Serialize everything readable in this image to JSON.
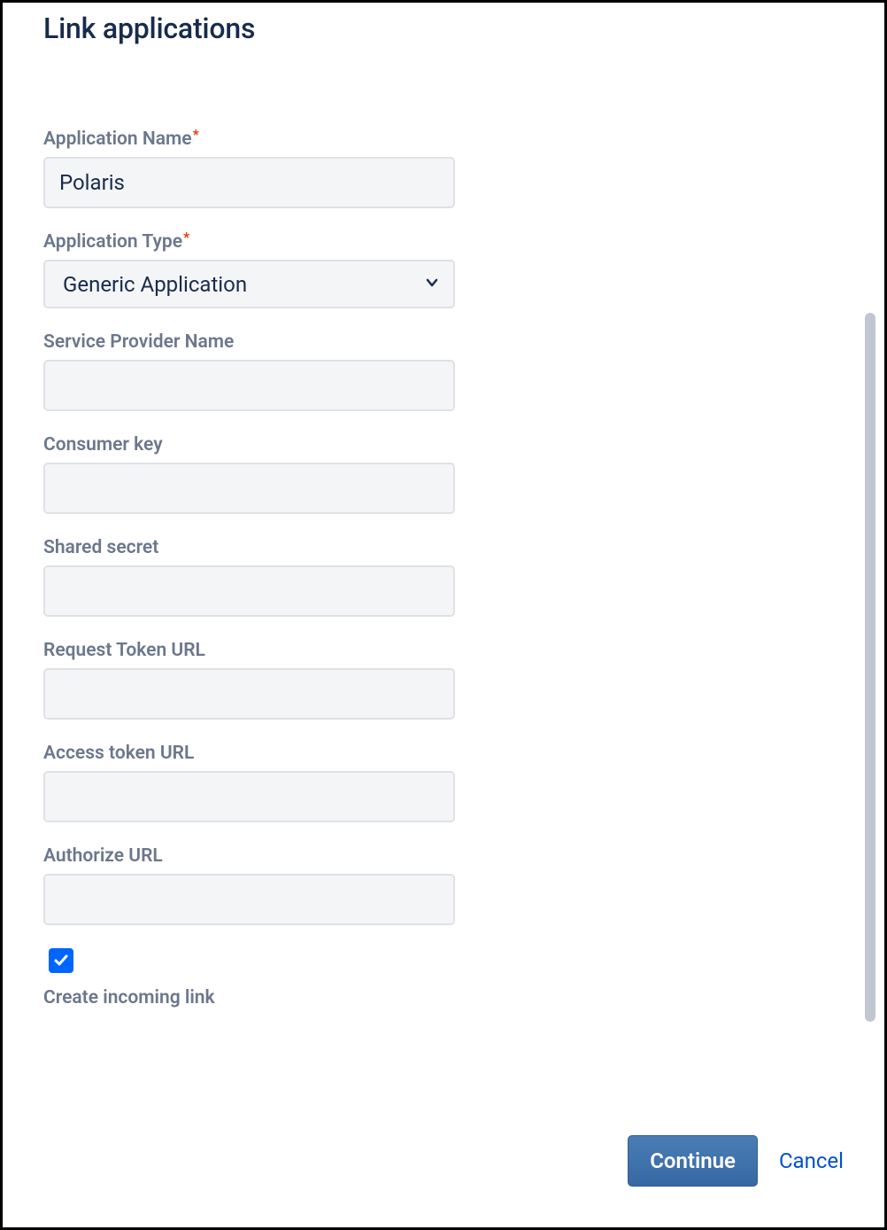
{
  "dialog": {
    "title": "Link applications"
  },
  "form": {
    "application_name": {
      "label": "Application Name",
      "value": "Polaris",
      "required": true
    },
    "application_type": {
      "label": "Application Type",
      "value": "Generic Application",
      "required": true
    },
    "service_provider_name": {
      "label": "Service Provider Name",
      "value": ""
    },
    "consumer_key": {
      "label": "Consumer key",
      "value": ""
    },
    "shared_secret": {
      "label": "Shared secret",
      "value": ""
    },
    "request_token_url": {
      "label": "Request Token URL",
      "value": ""
    },
    "access_token_url": {
      "label": "Access token URL",
      "value": ""
    },
    "authorize_url": {
      "label": "Authorize URL",
      "value": ""
    },
    "create_incoming_link": {
      "label": "Create incoming link",
      "checked": true
    }
  },
  "footer": {
    "continue": "Continue",
    "cancel": "Cancel"
  }
}
